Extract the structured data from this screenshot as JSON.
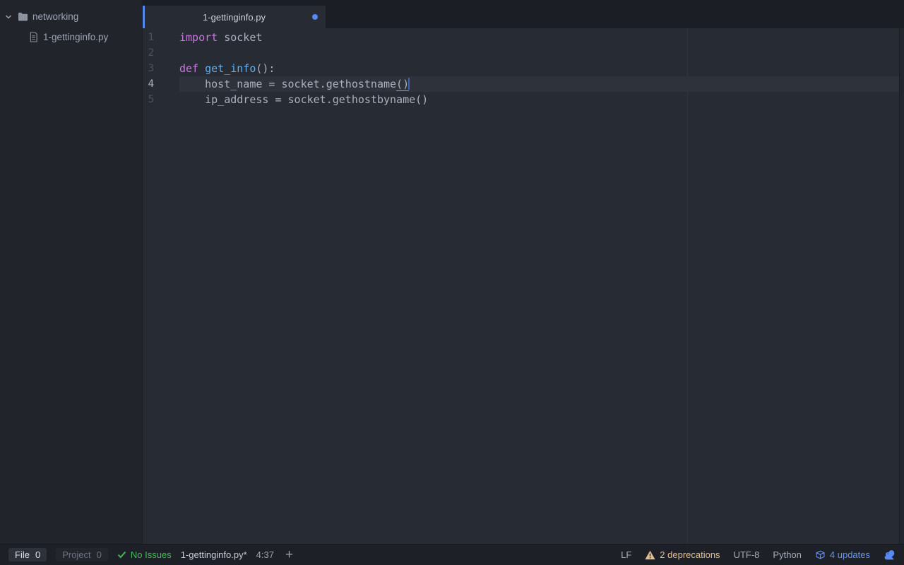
{
  "tree": {
    "root_folder": {
      "name": "networking",
      "expanded": true
    },
    "files": [
      {
        "name": "1-gettinginfo.py"
      }
    ]
  },
  "tab": {
    "title": "1-gettinginfo.py",
    "modified": true,
    "active": true
  },
  "editor": {
    "language": "Python",
    "lines": [
      {
        "number": "1",
        "tokens": [
          {
            "text": "import",
            "type": "keyword"
          },
          {
            "text": " socket",
            "type": "plain"
          }
        ]
      },
      {
        "number": "2",
        "tokens": []
      },
      {
        "number": "3",
        "tokens": [
          {
            "text": "def ",
            "type": "keyword"
          },
          {
            "text": "get_info",
            "type": "function"
          },
          {
            "text": "():",
            "type": "plain"
          }
        ]
      },
      {
        "number": "4",
        "active": true,
        "tokens": [
          {
            "text": "    host_name = socket.gethostname",
            "type": "plain"
          },
          {
            "text": "(",
            "type": "bracket-match"
          },
          {
            "text": ")",
            "type": "bracket-match"
          }
        ]
      },
      {
        "number": "5",
        "tokens": [
          {
            "text": "    ip_address = socket.gethostbyname()",
            "type": "plain"
          }
        ]
      }
    ]
  },
  "status_bar": {
    "linter_file": {
      "label": "File",
      "count": "0"
    },
    "linter_project": {
      "label": "Project",
      "count": "0"
    },
    "no_issues_label": "No Issues",
    "current_file": "1-gettinginfo.py*",
    "cursor_position": "4:37",
    "plus_glyph": "+",
    "line_ending": "LF",
    "deprecations_label": "2 deprecations",
    "encoding": "UTF-8",
    "grammar": "Python",
    "updates_label": "4 updates"
  },
  "icons": {
    "chevron_down": "chevron-down-icon",
    "folder": "folder-icon",
    "file": "file-text-icon",
    "check": "check-icon",
    "warning": "warning-triangle-icon",
    "package": "package-icon",
    "squirrel": "squirrel-icon",
    "plus": "plus-icon"
  },
  "colors": {
    "accent_blue": "#568af2",
    "cursor_blue": "#528bff",
    "success_green": "#44bb55",
    "warning_orange": "#e2c08d",
    "info_blue": "#6494ed",
    "syntax_keyword": "#c678dd",
    "syntax_function": "#61afef",
    "syntax_text": "#abb2bf",
    "editor_bg": "#272b33",
    "panel_bg": "#21252b",
    "statusbar_bg": "#1d2026"
  }
}
